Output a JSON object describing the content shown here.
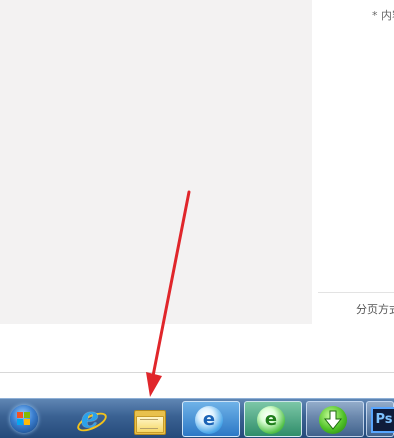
{
  "document": {
    "required_note": "* 内容",
    "pagination_label": "分页方式"
  },
  "taskbar": {
    "items": [
      {
        "name": "start",
        "icon": "windows-start-orb-icon"
      },
      {
        "name": "internet-explorer",
        "icon": "internet-explorer-icon"
      },
      {
        "name": "file-explorer",
        "icon": "folder-icon"
      },
      {
        "name": "ie-browser-open",
        "icon": "blue-e-browser-icon",
        "glyph": "e"
      },
      {
        "name": "green-browser-open",
        "icon": "green-e-browser-icon",
        "glyph": "e"
      },
      {
        "name": "download-manager-open",
        "icon": "download-arrow-icon"
      },
      {
        "name": "photoshop-open",
        "icon": "photoshop-icon",
        "glyph": "Ps"
      }
    ]
  },
  "colors": {
    "annotation_arrow": "#e0262b",
    "taskbar_top": "#5f86b4",
    "taskbar_bottom": "#244a7a"
  }
}
